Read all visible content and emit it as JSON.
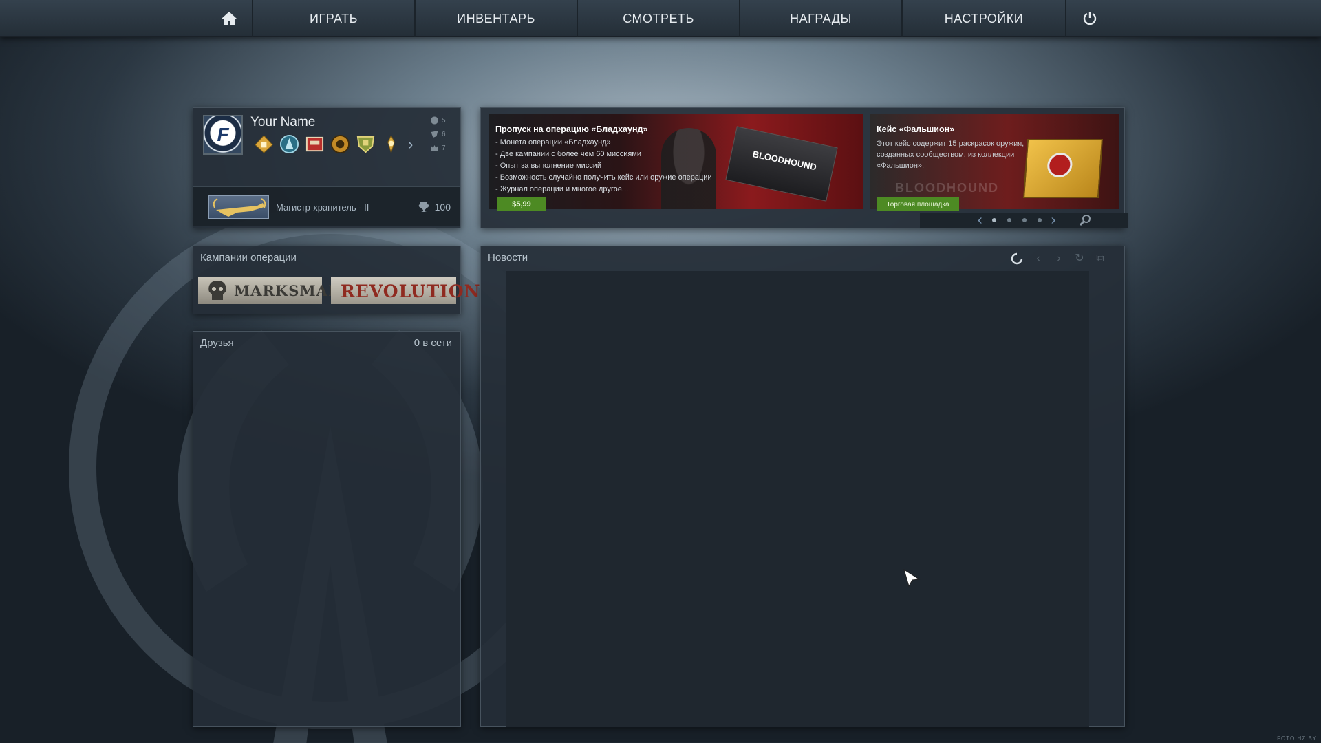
{
  "nav": {
    "home_icon": "home-icon",
    "items": [
      {
        "label": "ИГРАТЬ"
      },
      {
        "label": "ИНВЕНТАРЬ"
      },
      {
        "label": "СМОТРЕТЬ"
      },
      {
        "label": "НАГРАДЫ"
      },
      {
        "label": "НАСТРОЙКИ"
      }
    ],
    "power_icon": "power-icon"
  },
  "profile": {
    "name": "Your Name",
    "avatar_letter": "F",
    "stats": [
      {
        "icon": "smiley-icon",
        "value": "5"
      },
      {
        "icon": "teacher-icon",
        "value": "6"
      },
      {
        "icon": "crown-icon",
        "value": "7"
      }
    ],
    "rank": {
      "label": "Магистр-хранитель - II",
      "points": "100"
    }
  },
  "campaigns": {
    "title": "Кампании операции",
    "banners": [
      "MARKSMAN",
      "REVOLUTION"
    ]
  },
  "friends": {
    "title": "Друзья",
    "online": "0 в сети"
  },
  "carousel": {
    "slide1": {
      "title": "Пропуск на операцию «Бладхаунд»",
      "lines": [
        "- Монета операции «Бладхаунд»",
        "- Две кампании с более чем 60 миссиями",
        "- Опыт за выполнение миссий",
        "- Возможность случайно получить кейс или оружие операции",
        "- Журнал операции и многое другое..."
      ],
      "price": "$5,99",
      "art_label": "BLOODHOUND"
    },
    "slide2": {
      "title": "Кейс «Фальшион»",
      "desc": "Этот кейс содержит 15 раскрасок оружия, созданных сообществом, из коллекции «Фальшион».",
      "button": "Торговая площадка",
      "watermark": "BLOODHOUND"
    }
  },
  "news": {
    "title": "Новости"
  },
  "watermark": "FOTO.HZ.BY",
  "colors": {
    "accent_green": "#4d8a23",
    "nav_bg": "#2b3641"
  }
}
